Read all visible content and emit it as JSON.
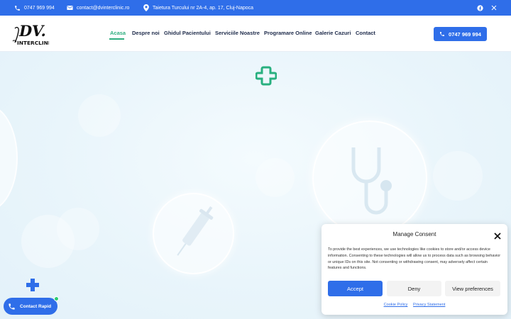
{
  "topbar": {
    "phone": "0747 969 994",
    "email": "contact@dvinterclinic.ro",
    "address": "Taietura Turcului nr 2A-4, ap. 17, Cluj-Napoca",
    "social": [
      "facebook-icon",
      "x-icon"
    ]
  },
  "header": {
    "logo_text": "DV.",
    "logo_sub": "INTERCLINIC",
    "nav": [
      "Acasa",
      "Despre noi",
      "Ghidul Pacientului",
      "Serviciile Noastre",
      "Programare Online",
      "Galerie Cazuri",
      "Contact"
    ],
    "active_nav": "Acasa",
    "phone_button": "0747 969 994"
  },
  "consent": {
    "title": "Manage Consent",
    "text": "To provide the best experiences, we use technologies like cookies to store and/or access device information. Consenting to these technologies will allow us to process data such as browsing behavior or unique IDs on this site. Not consenting or withdrawing consent, may adversely affect certain features and functions.",
    "accept": "Accept",
    "deny": "Deny",
    "preferences": "View preferences",
    "cookie_policy": "Cookie Policy",
    "privacy_statement": "Privacy Statement"
  },
  "contact_rapid": {
    "label": "Contact Rapid"
  },
  "colors": {
    "primary": "#2f6ee9",
    "accent_green": "#2fae7f",
    "nav_text": "#1d2a4a"
  }
}
